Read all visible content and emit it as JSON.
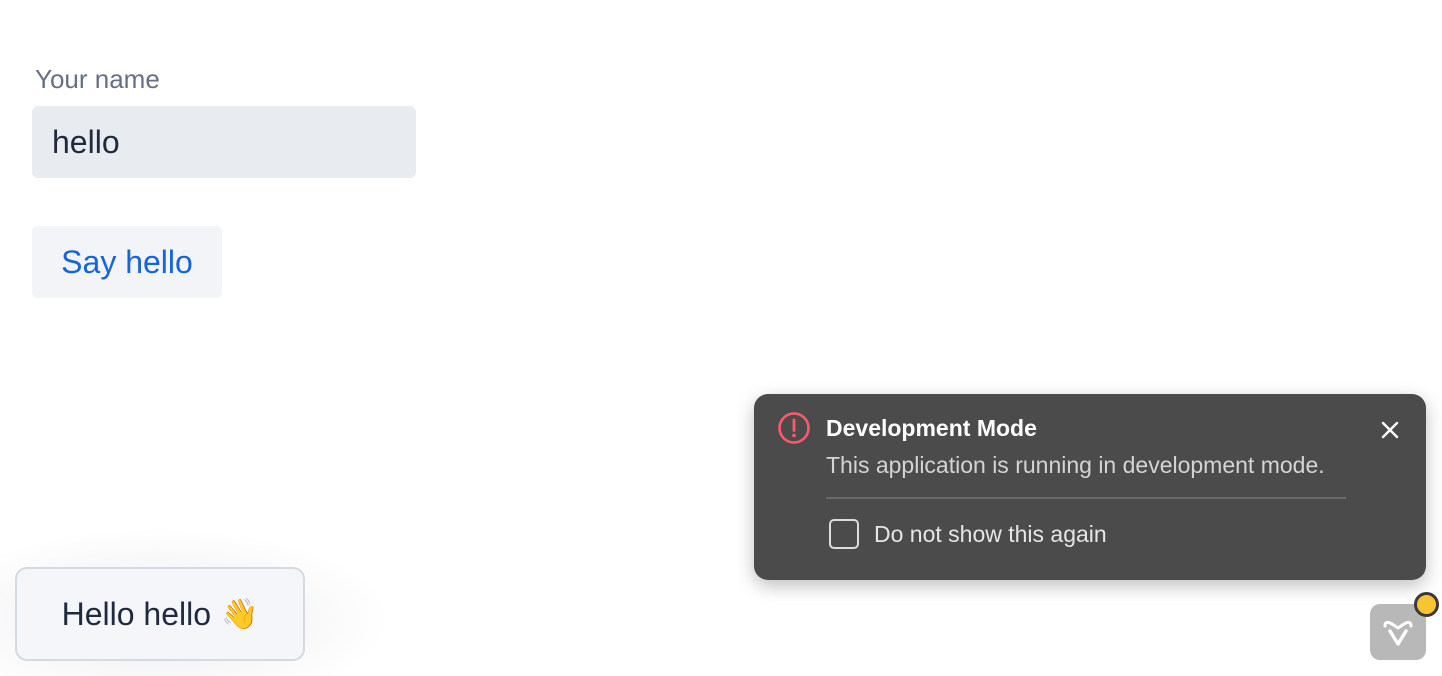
{
  "form": {
    "name_label": "Your name",
    "name_value": "hello",
    "say_hello_label": "Say hello"
  },
  "notification": {
    "text": "Hello hello",
    "emoji": "👋"
  },
  "dev_mode_popup": {
    "title": "Development Mode",
    "message": "This application is running in development mode.",
    "checkbox_label": "Do not show this again",
    "checkbox_checked": false,
    "warning_color": "#ff5a6b"
  },
  "devtools": {
    "icon": "vaadin-logo-icon",
    "status_color": "#f7c533"
  },
  "colors": {
    "accent": "#1565d8",
    "input_bg": "#e8ebf0",
    "popup_bg": "#4b4b4b"
  }
}
